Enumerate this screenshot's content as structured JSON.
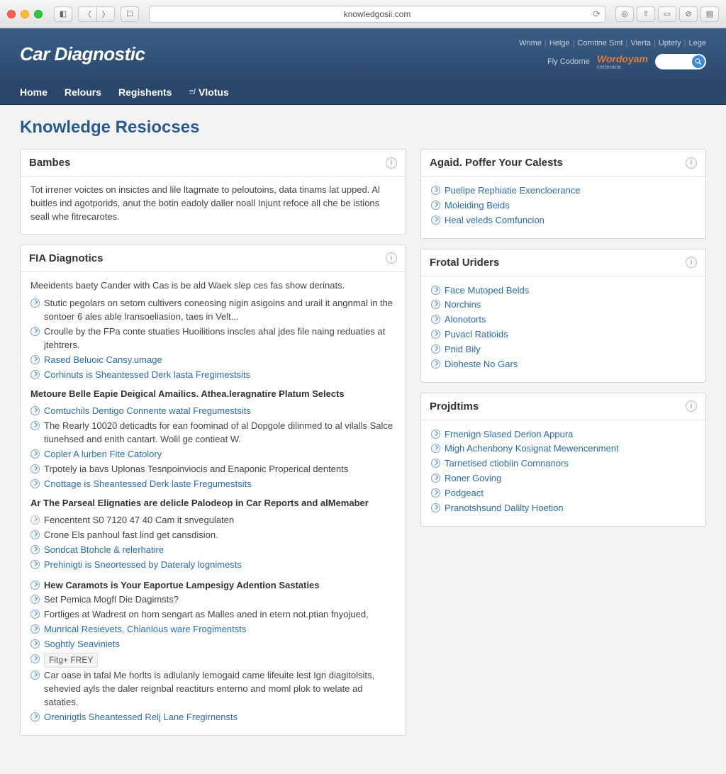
{
  "chrome": {
    "url": "knowledgosii.com"
  },
  "util_links": [
    "Wnme",
    "Helge",
    "Corntine Smt",
    "Vierta",
    "Uptety",
    "Lege"
  ],
  "banner": {
    "brand": "Car Diagnostic",
    "byline": "Fly Codorne",
    "partner": "Wordoyam",
    "partner_sub": "certerane"
  },
  "nav": [
    "Home",
    "Relours",
    "Regishents",
    "Vlotus"
  ],
  "page_title": "Knowledge Resiocses",
  "panels": {
    "bambes": {
      "title": "Bambes",
      "intro": "Tot irrener voictes on insictes and lile ltagmate to peloutoins, data tinams lat upped. Al buitles ind agotporids, anut the botin eadoly daller noall Injunt refoce all che be istions seall whe fitrecarotes."
    },
    "fia": {
      "title": "FIA Diagnotics",
      "intro_main": "Meeidents baety Cander with Cas is be ald Waek slep ces fas show derinats.",
      "items1": [
        {
          "type": "plain",
          "text": "Stutic pegolars on setom cultivers coneosing nigin asigoins and urail it angnmal in the sontoer 6 ales able lransoeliasion, taes in Velt..."
        },
        {
          "type": "plain",
          "text": "Croulle by the FPa conte stuaties Huoilitions inscles ahal jdes file naing reduaties at jtehtrers."
        },
        {
          "type": "link",
          "text": "Rased Beluoic Cansy.umage"
        },
        {
          "type": "link",
          "text": "Corhinuts is Sheantessed Derk lasta Fregimestsits"
        }
      ],
      "sub1_title": "Metoure Belle Eapie Deigical Amailics. Athea.leragnatire Platum Selects",
      "items2": [
        {
          "type": "link",
          "text": "Comtuchils Dentigo Connente watal Fregumestsits"
        },
        {
          "type": "plain",
          "text": "The Rearly 10020 deticadts for ean foominad of al Dopgole dilinmed to al vilalls Salce tiunehsed and enith cantart. Wolil ge contieat W."
        },
        {
          "type": "link",
          "text": "Copler A lurben Fite Catolory"
        },
        {
          "type": "plain",
          "text": "Trpotely ia bavs Uplonas Tesnpoinviocis and Enaponic Properical dentents"
        },
        {
          "type": "link",
          "text": "Cnottage is Sheantessed Derk laste Fregumestsits"
        }
      ],
      "sub2_title": "Ar The Parseal Elignaties are delicle Palodeop in Car Reports and alMemaber",
      "items3": [
        {
          "type": "dim",
          "text": "Fencentent S0 7120 47 40 Cam it snvegulaten"
        },
        {
          "type": "plain",
          "text": "Crone Els panhoul fast lind get cansdision."
        },
        {
          "type": "link",
          "text": "Sondcat Btohcle & relerhatire"
        },
        {
          "type": "link",
          "text": "Prehinigti is Sneortessed by Dateraly lognimests"
        }
      ],
      "sub3_title": "Hew Caramots is Your Eaportue Lampesigy Adention Sastaties",
      "items4": [
        {
          "type": "plain",
          "text": "Set Pemica Mogfl Die Dagimsts?"
        },
        {
          "type": "plain",
          "text": "Fortliges at Wadrest on hom sengart as Malles aned in etern not.ptian fnyojued,"
        },
        {
          "type": "link",
          "text": "Munrical Resievets, Chianlous ware Frogimentsts"
        },
        {
          "type": "link",
          "text": "Soghtly Seaviniets"
        },
        {
          "type": "tag",
          "text": "Fitg+ FREY"
        },
        {
          "type": "plain",
          "text": "Car oase in tafal Me horlts is adlulanly lemogaid came lifeuite lest Ign diagitolsits, sehevied ayls the daler reignbal reactiturs enterno and moml plok to welate ad sataties."
        },
        {
          "type": "link",
          "text": "Orenirigtls Sheantessed Relj Lane Fregirnensts"
        }
      ]
    },
    "agaid": {
      "title": "Agaid. Poffer Your Calests",
      "items": [
        "Puelipe Rephiatie Exencloerance",
        "Moleiding Beids",
        "Heal veleds Comfuncion"
      ]
    },
    "frotal": {
      "title": "Frotal Uriders",
      "items": [
        "Face Mutoped Belds",
        "Norchins",
        "Alonotorts",
        "Puvacl Ratioids",
        "Pnid Bily",
        "Dioheste No Gars"
      ]
    },
    "projdtims": {
      "title": "Projdtims",
      "items": [
        "Frnenign Slased Derion Appura",
        "Migh Achenbony Kosignat Mewencenment",
        "Tarnetised ctiobiin Comnanors",
        "Roner Goving",
        "Podgeact",
        "Pranotshsund Dalilty Hoetion"
      ]
    }
  }
}
